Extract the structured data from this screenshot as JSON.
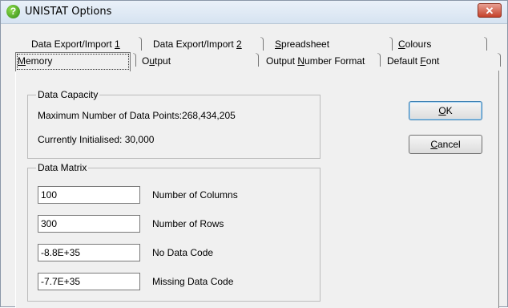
{
  "window": {
    "title": "UNISTAT Options",
    "close_glyph": "✕",
    "app_icon_glyph": "?"
  },
  "tabs": {
    "row1": [
      {
        "pre": "Data Export/Import ",
        "key": "1",
        "post": ""
      },
      {
        "pre": "Data Export/Import ",
        "key": "2",
        "post": ""
      },
      {
        "pre": "",
        "key": "S",
        "post": "preadsheet"
      },
      {
        "pre": "",
        "key": "C",
        "post": "olours"
      }
    ],
    "row2": [
      {
        "pre": "",
        "key": "M",
        "post": "emory"
      },
      {
        "pre": "O",
        "key": "u",
        "post": "tput"
      },
      {
        "pre": "Output ",
        "key": "N",
        "post": "umber Format"
      },
      {
        "pre": "Default ",
        "key": "F",
        "post": "ont"
      }
    ],
    "active": "Memory"
  },
  "data_capacity": {
    "legend": "Data Capacity",
    "max_points": "Maximum Number of Data Points:268,434,205",
    "initialised": "Currently Initialised: 30,000"
  },
  "data_matrix": {
    "legend": "Data Matrix",
    "rows": [
      {
        "value": "100",
        "label": "Number of Columns"
      },
      {
        "value": "300",
        "label": "Number of Rows"
      },
      {
        "value": "-8.8E+35",
        "label": "No Data Code"
      },
      {
        "value": "-7.7E+35",
        "label": "Missing Data Code"
      }
    ]
  },
  "buttons": {
    "ok": {
      "key": "O",
      "post": "K"
    },
    "cancel": {
      "key": "C",
      "post": "ancel"
    }
  }
}
